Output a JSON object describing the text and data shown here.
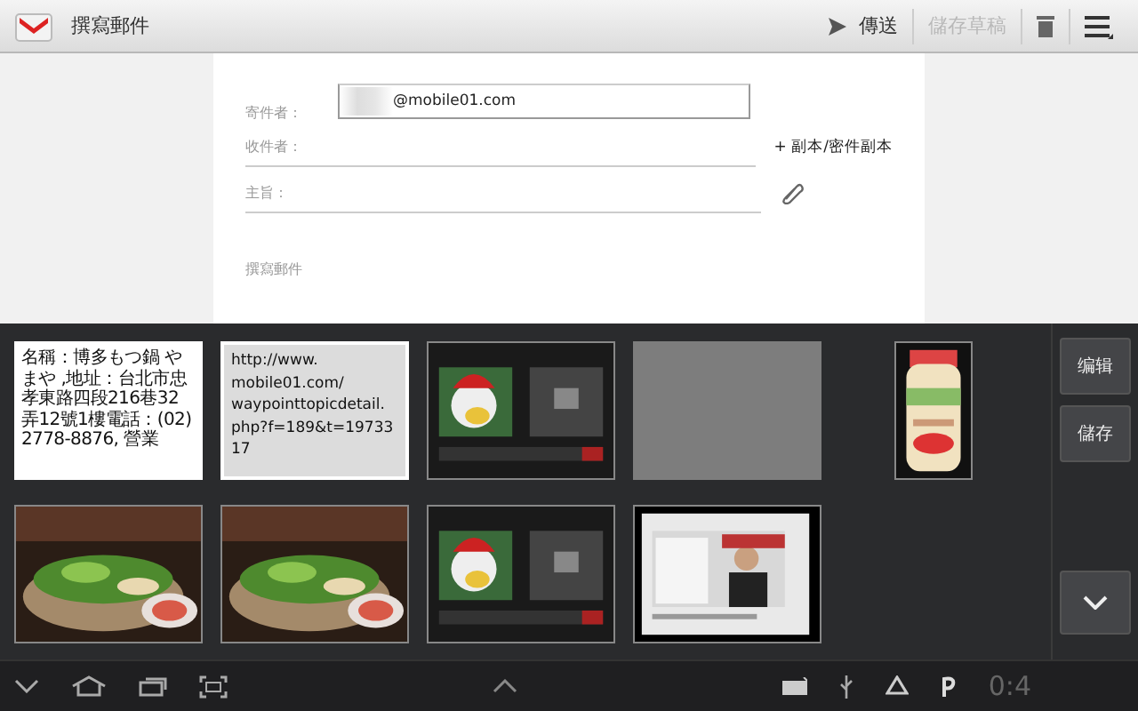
{
  "action_bar": {
    "title": "撰寫郵件",
    "send": {
      "label": "傳送",
      "disabled": false
    },
    "save_draft": {
      "label": "儲存草稿",
      "disabled": true
    }
  },
  "compose": {
    "from_label": "寄件者：",
    "from_value": "@mobile01.com",
    "to_label": "收件者：",
    "cc_bcc": "+ 副本/密件副本",
    "subject_label": "主旨：",
    "body_placeholder": "撰寫郵件"
  },
  "clipboard": {
    "items": [
      {
        "kind": "text",
        "text": "名稱：博多もつ鍋 やまや ,地址：台北市忠孝東路四段216巷32弄12號1樓電話：(02)2778-8876, 營業"
      },
      {
        "kind": "text",
        "text": "http://www.\nmobile01.com/\nwaypointtopicdetail.\nphp?f=189&t=1973317"
      },
      {
        "kind": "picture"
      },
      {
        "kind": "blank"
      },
      {
        "kind": "picture"
      },
      {
        "kind": "picture"
      },
      {
        "kind": "picture"
      },
      {
        "kind": "picture"
      },
      {
        "kind": "picture"
      }
    ],
    "buttons": [
      "编辑",
      "儲存"
    ]
  },
  "status_bar": {
    "clock": "0:4"
  }
}
